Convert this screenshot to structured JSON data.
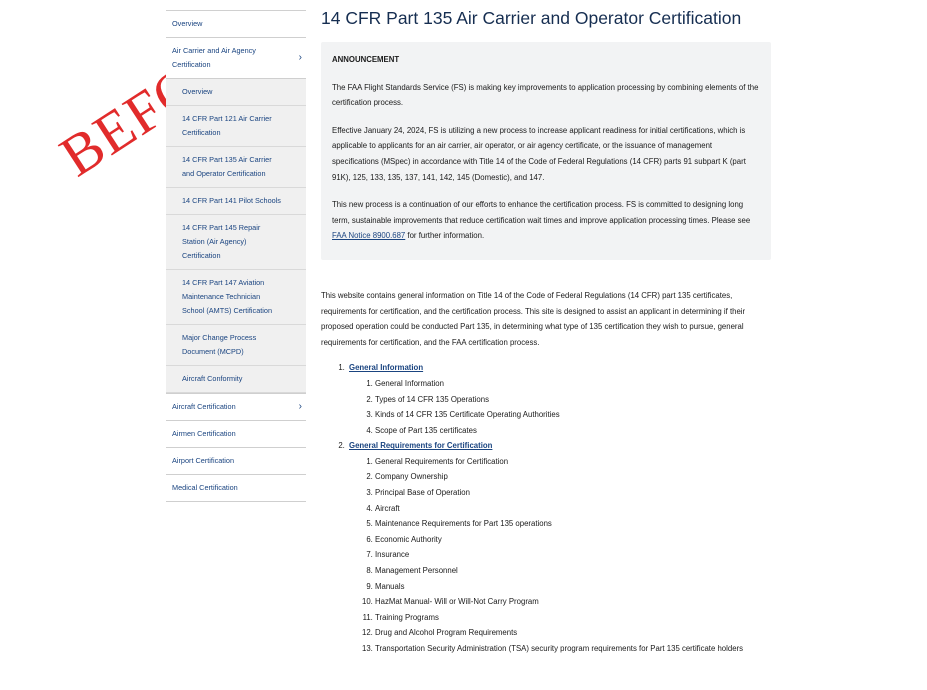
{
  "stamp": {
    "text": "BEFORE",
    "color": "#e02020"
  },
  "sidebar": {
    "top_items_before": [
      {
        "label": "Overview"
      }
    ],
    "expanded": {
      "label": "Air Carrier and Air Agency Certification",
      "children": [
        {
          "label": "Overview"
        },
        {
          "label": "14 CFR Part 121 Air Carrier Certification"
        },
        {
          "label": "14 CFR Part 135 Air Carrier and Operator Certification"
        },
        {
          "label": "14 CFR Part 141 Pilot Schools"
        },
        {
          "label": "14 CFR Part 145 Repair Station (Air Agency) Certification"
        },
        {
          "label": "14 CFR Part 147 Aviation Maintenance Technician School (AMTS) Certification"
        },
        {
          "label": "Major Change Process Document (MCPD)"
        },
        {
          "label": "Aircraft Conformity"
        }
      ]
    },
    "items_after": [
      {
        "label": "Aircraft Certification",
        "has_children": true
      },
      {
        "label": "Airmen Certification",
        "has_children": false
      },
      {
        "label": "Airport Certification",
        "has_children": false
      },
      {
        "label": "Medical Certification",
        "has_children": false
      }
    ]
  },
  "main": {
    "title": "14 CFR Part 135 Air Carrier and Operator Certification",
    "announcement": {
      "heading": "ANNOUNCEMENT",
      "p1": "The FAA Flight Standards Service (FS) is making key improvements to application processing by combining elements of the certification process.",
      "p2": "Effective January 24, 2024, FS is utilizing a new process to increase applicant readiness for initial certifications, which is applicable to applicants for an air carrier, air operator, or air agency certificate, or the issuance of management specifications (MSpec) in accordance with Title 14 of the Code of Federal Regulations (14 CFR) parts 91 subpart K (part 91K), 125, 133, 135, 137, 141, 142, 145 (Domestic), and 147.",
      "p3_before": "This new process is a continuation of our efforts to enhance the certification process.  FS is committed to designing long term, sustainable improvements that reduce certification wait times and improve application processing times. Please see ",
      "p3_link": "FAA Notice 8900.687",
      "p3_after": " for further information."
    },
    "intro": "This website contains general information on Title 14 of the Code of Federal Regulations (14 CFR) part 135 certificates, requirements for certification, and the certification process. This site is designed to assist an applicant in determining if their proposed operation could be conducted Part 135, in determining what type of 135 certification they wish to pursue, general requirements for certification, and the FAA certification process.",
    "sections": [
      {
        "title": "General Information",
        "items": [
          "General Information",
          "Types of 14 CFR 135 Operations",
          "Kinds of 14 CFR 135 Certificate Operating Authorities",
          "Scope of Part 135 certificates"
        ]
      },
      {
        "title": "General Requirements for Certification",
        "items": [
          "General Requirements for Certification",
          "Company Ownership",
          "Principal Base of Operation",
          "Aircraft",
          "Maintenance Requirements for Part 135 operations",
          "Economic Authority",
          "Insurance",
          "Management Personnel",
          "Manuals",
          "HazMat Manual- Will or Will-Not Carry Program",
          "Training Programs",
          "Drug and Alcohol Program Requirements",
          "Transportation Security Administration (TSA) security program requirements for Part 135 certificate holders"
        ]
      }
    ]
  }
}
